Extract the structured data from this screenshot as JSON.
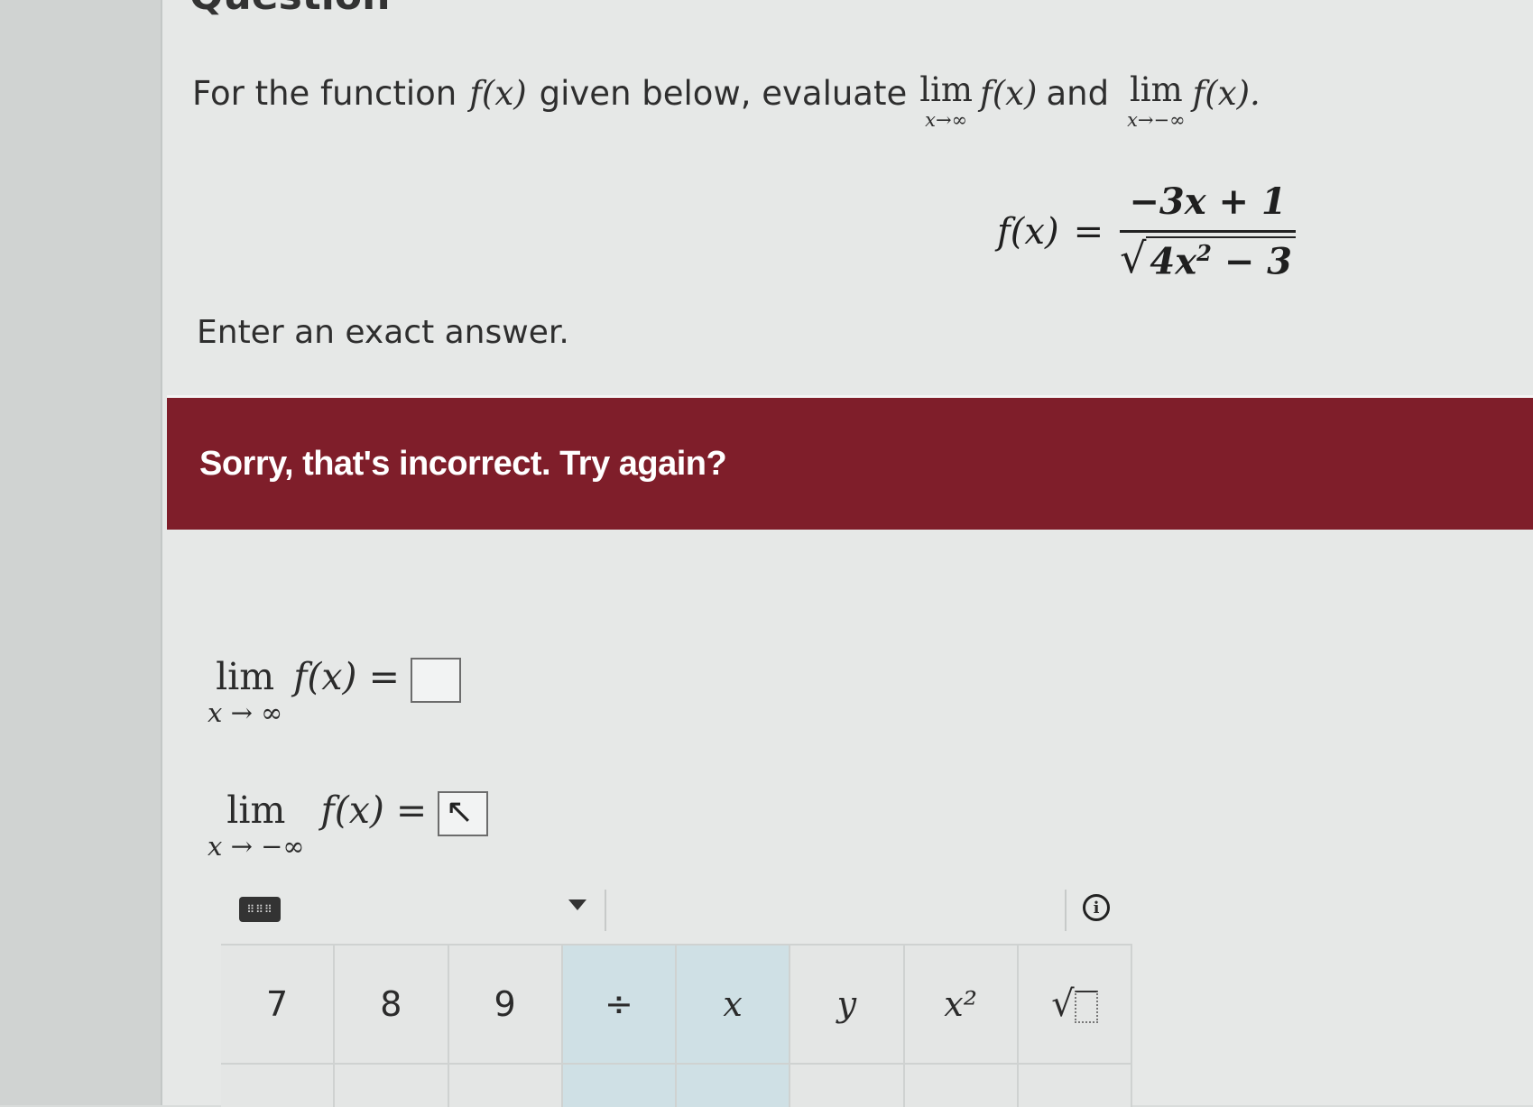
{
  "page": {
    "heading": "Question",
    "question_prefix": "For the function",
    "question_fx": "f(x)",
    "question_mid": "given below, evaluate",
    "limit1": {
      "lim": "lim",
      "sub": "x→∞",
      "fx": "f(x)"
    },
    "question_and": "and",
    "limit2": {
      "lim": "lim",
      "sub": "x→−∞",
      "fx": "f(x)."
    },
    "formula": {
      "lhs": "f(x)",
      "eq": "=",
      "numerator": "−3x + 1",
      "radical": "√",
      "denominator_base": "4x",
      "denominator_exp": "2",
      "denominator_rest": " − 3"
    },
    "instruction": "Enter an exact answer."
  },
  "feedback": {
    "message": "Sorry, that's incorrect. Try again?",
    "color": "#7f1e2a"
  },
  "answers": [
    {
      "lim": "lim",
      "sub": "x → ∞",
      "rhs": "f(x) =",
      "value": ""
    },
    {
      "lim": "lim",
      "sub": "x → −∞",
      "rhs": "f(x) =",
      "value": ""
    }
  ],
  "toolbar": {
    "keyboard_icon": "keyboard-icon",
    "dropdown_icon": "chevron-down-icon",
    "info_icon": "info-icon",
    "info_glyph": "i"
  },
  "keypad": {
    "keys": [
      "7",
      "8",
      "9",
      "÷",
      "x",
      "y",
      "x²",
      "√"
    ]
  }
}
